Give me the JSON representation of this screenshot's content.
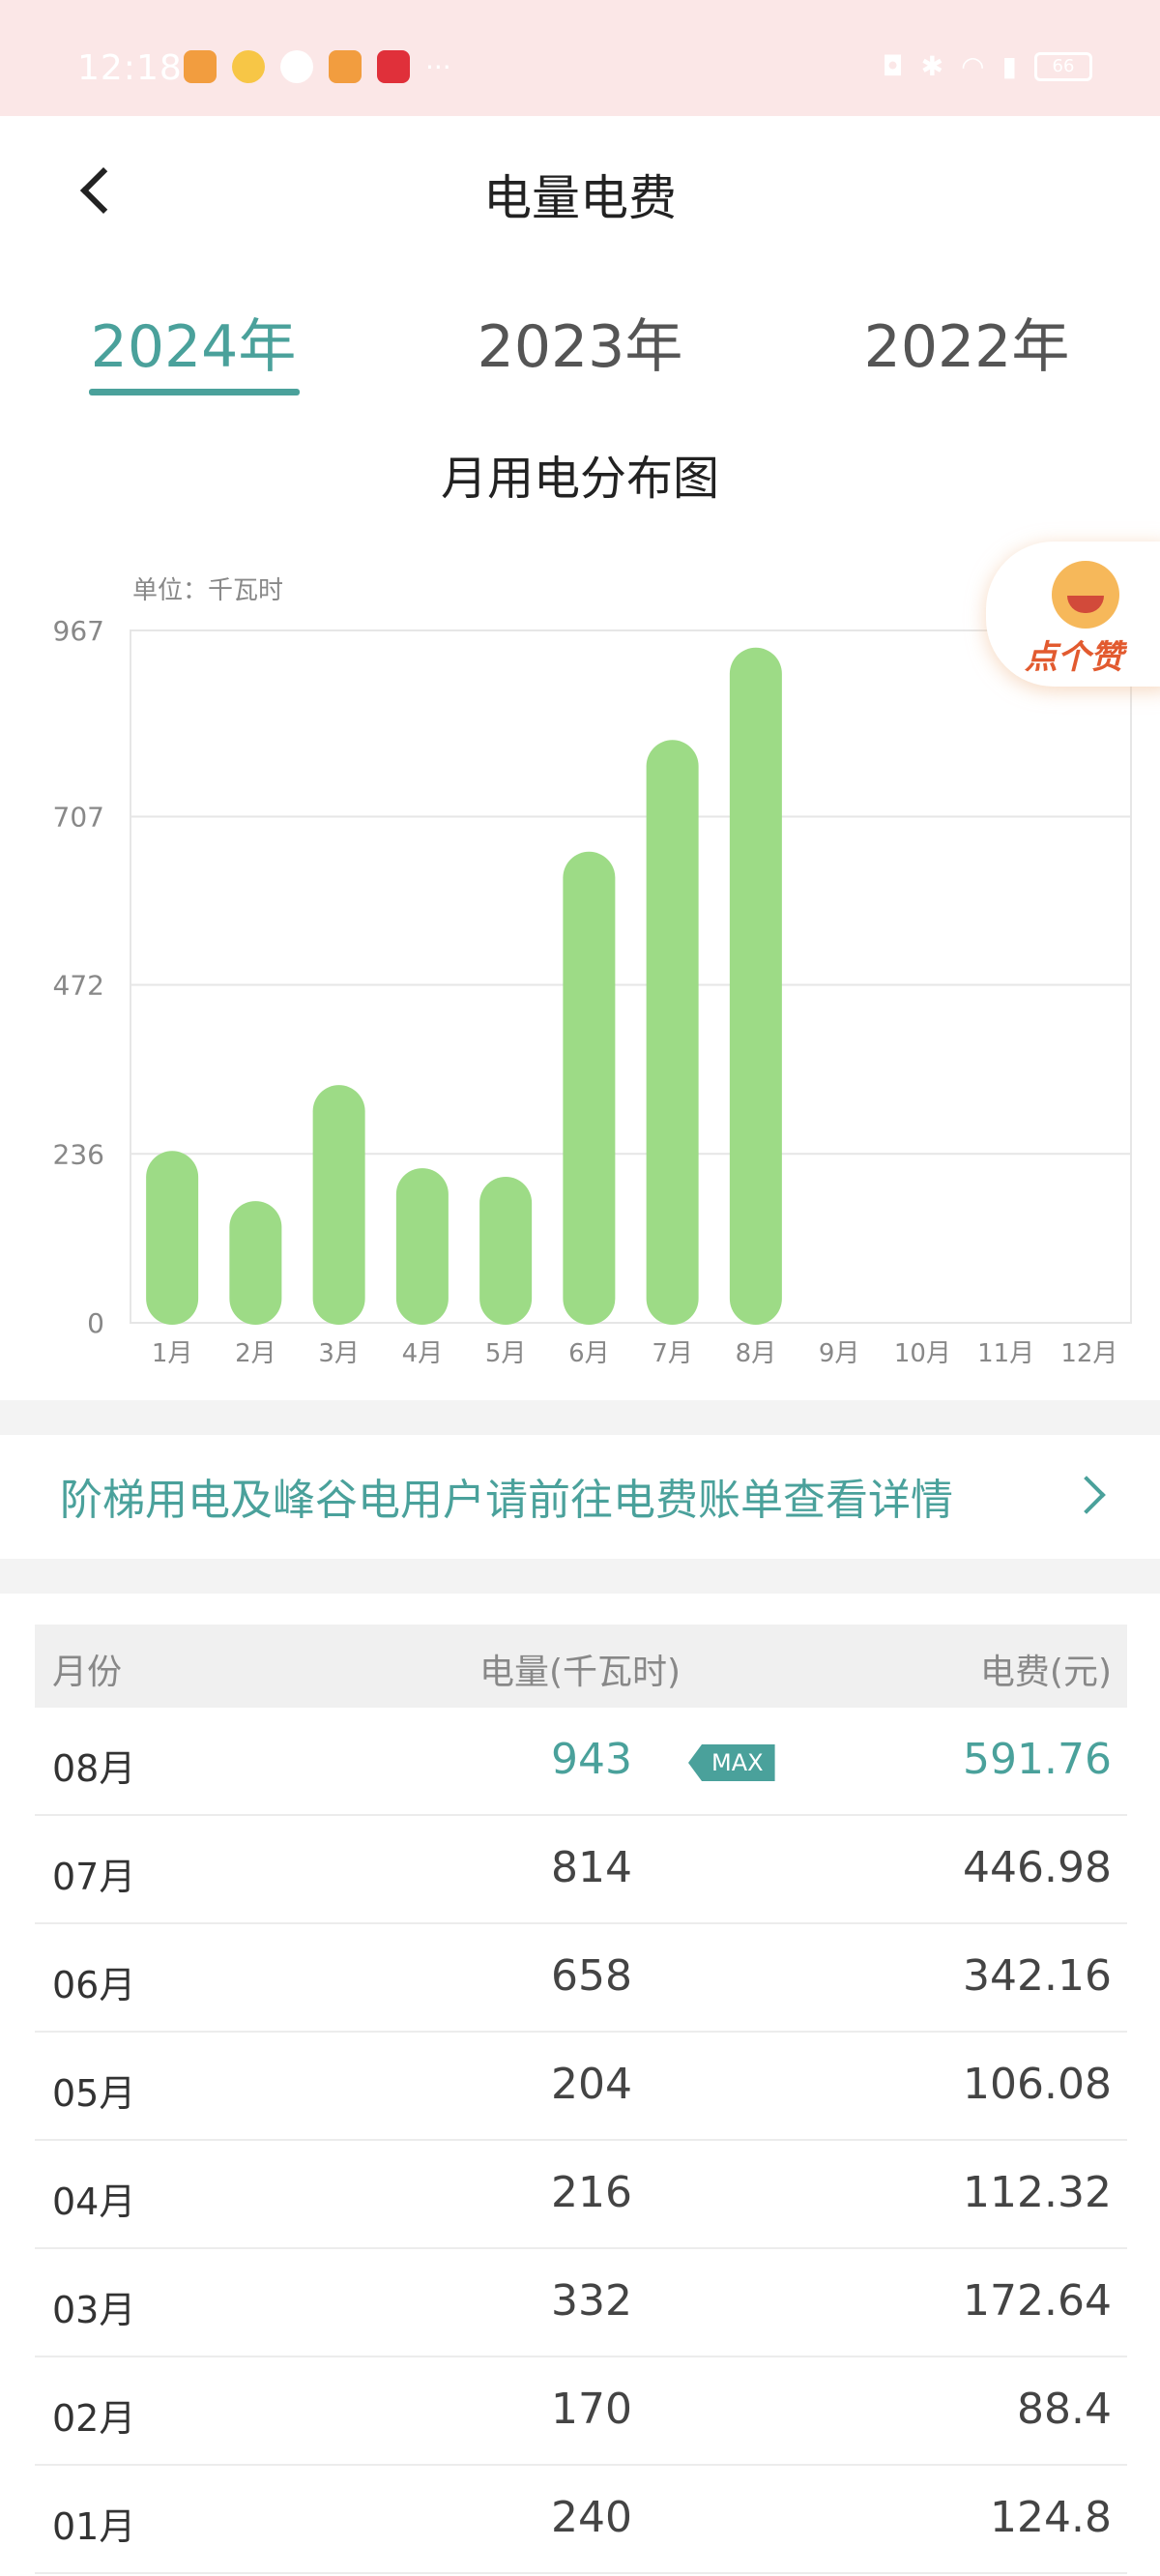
{
  "status_bar": {
    "time": "12:18",
    "battery": "66"
  },
  "header": {
    "title": "电量电费"
  },
  "year_tabs": [
    {
      "label": "2024年",
      "active": true
    },
    {
      "label": "2023年",
      "active": false
    },
    {
      "label": "2022年",
      "active": false
    }
  ],
  "chart": {
    "title": "月用电分布图",
    "unit": "单位：千瓦时"
  },
  "chart_data": {
    "type": "bar",
    "categories": [
      "1月",
      "2月",
      "3月",
      "4月",
      "5月",
      "6月",
      "7月",
      "8月",
      "9月",
      "10月",
      "11月",
      "12月"
    ],
    "values": [
      240,
      170,
      332,
      216,
      204,
      658,
      814,
      943,
      null,
      null,
      null,
      null
    ],
    "yticks": [
      0,
      236,
      472,
      707,
      967
    ],
    "ylim": [
      0,
      967
    ],
    "bar_color": "#9ddb86",
    "grid": true
  },
  "like_badge": {
    "label": "点个赞"
  },
  "notice": {
    "text": "阶梯用电及峰谷电用户请前往电费账单查看详情"
  },
  "table": {
    "headers": {
      "month": "月份",
      "kwh": "电量(千瓦时)",
      "fee": "电费(元)"
    },
    "max_label": "MAX",
    "rows": [
      {
        "month": "08月",
        "kwh": "943",
        "fee": "591.76",
        "max": true
      },
      {
        "month": "07月",
        "kwh": "814",
        "fee": "446.98"
      },
      {
        "month": "06月",
        "kwh": "658",
        "fee": "342.16"
      },
      {
        "month": "05月",
        "kwh": "204",
        "fee": "106.08"
      },
      {
        "month": "04月",
        "kwh": "216",
        "fee": "112.32"
      },
      {
        "month": "03月",
        "kwh": "332",
        "fee": "172.64"
      },
      {
        "month": "02月",
        "kwh": "170",
        "fee": "88.4"
      },
      {
        "month": "01月",
        "kwh": "240",
        "fee": "124.8"
      }
    ]
  },
  "colors": {
    "accent": "#4aa19b",
    "bar": "#9ddb86",
    "status_bar_bg": "#fbe7e7"
  }
}
